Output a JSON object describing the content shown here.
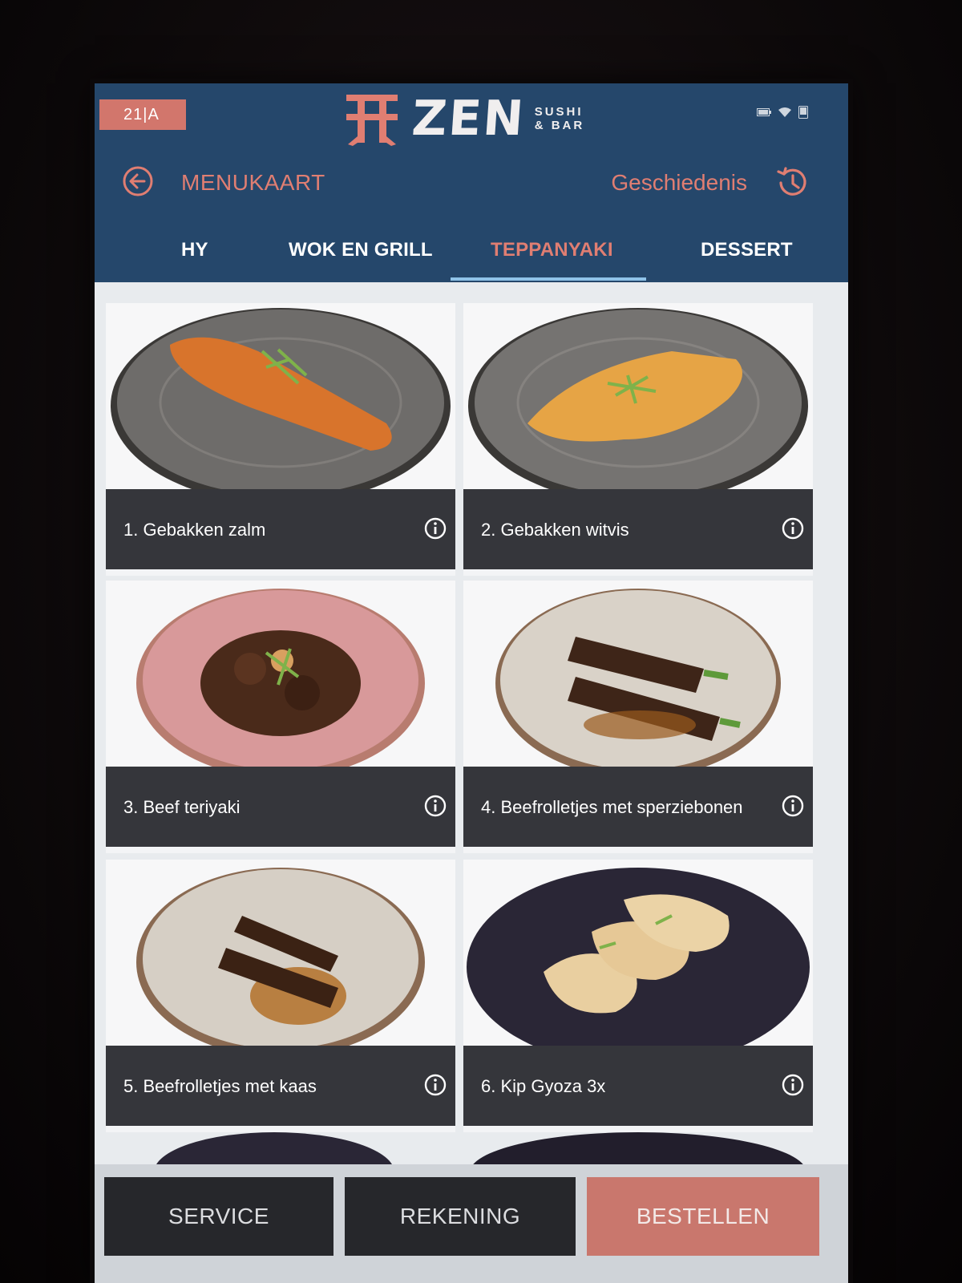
{
  "header": {
    "table_number": "21|A",
    "brand_name": "ZEN",
    "brand_sub_line1": "SUSHI",
    "brand_sub_line2": "& BAR",
    "status_icons": [
      "battery-icon",
      "wifi-icon",
      "device-icon"
    ]
  },
  "nav": {
    "back_label": "MENUKAART",
    "history_label": "Geschiedenis"
  },
  "tabs": [
    {
      "label": "HY",
      "active": false
    },
    {
      "label": "WOK EN GRILL",
      "active": false
    },
    {
      "label": "TEPPANYAKI",
      "active": true
    },
    {
      "label": "DESSERT",
      "active": false
    }
  ],
  "items": [
    {
      "name": "1. Gebakken zalm",
      "plate": "#6e6c6a",
      "food": "#d8742c"
    },
    {
      "name": "2. Gebakken witvis",
      "plate": "#757371",
      "food": "#e6a445"
    },
    {
      "name": "3. Beef teriyaki",
      "plate": "#d8999a",
      "food": "#4a2a1a"
    },
    {
      "name": "4. Beefrolletjes met sperziebonen",
      "plate": "#d9d2c8",
      "food": "#3e2518"
    },
    {
      "name": "5. Beefrolletjes met kaas",
      "plate": "#d6cfc5",
      "food": "#3b2214"
    },
    {
      "name": "6. Kip Gyoza 3x",
      "plate": "#2a2636",
      "food": "#e9cfa0"
    }
  ],
  "buttons": {
    "service": "SERVICE",
    "bill": "REKENING",
    "order": "BESTELLEN"
  },
  "colors": {
    "header_bg": "#25476b",
    "accent": "#e07e72",
    "card_bar": "#35363b",
    "order_button": "#c9776d"
  }
}
